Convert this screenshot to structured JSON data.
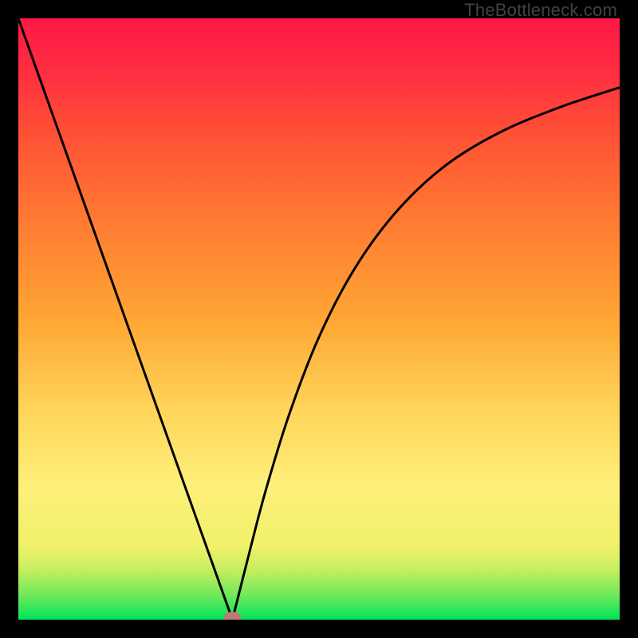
{
  "watermark": "TheBottleneck.com",
  "chart_data": {
    "type": "line",
    "title": "",
    "xlabel": "",
    "ylabel": "",
    "xlim": [
      0,
      1
    ],
    "ylim": [
      0,
      1
    ],
    "gradient_stops": [
      {
        "offset": 0.0,
        "color": "#00e45a"
      },
      {
        "offset": 0.04,
        "color": "#6de95a"
      },
      {
        "offset": 0.08,
        "color": "#c0ee5f"
      },
      {
        "offset": 0.12,
        "color": "#f0f16a"
      },
      {
        "offset": 0.22,
        "color": "#fdf07a"
      },
      {
        "offset": 0.35,
        "color": "#ffd459"
      },
      {
        "offset": 0.5,
        "color": "#ffa634"
      },
      {
        "offset": 0.65,
        "color": "#ff7e32"
      },
      {
        "offset": 0.8,
        "color": "#ff5335"
      },
      {
        "offset": 0.92,
        "color": "#ff2b41"
      },
      {
        "offset": 1.0,
        "color": "#ff1846"
      }
    ],
    "series": [
      {
        "name": "left-branch",
        "x": [
          0.0,
          0.356
        ],
        "y": [
          1.0,
          0.0
        ]
      },
      {
        "name": "right-branch",
        "x": [
          0.356,
          0.38,
          0.41,
          0.45,
          0.5,
          0.56,
          0.63,
          0.71,
          0.8,
          0.9,
          1.0
        ],
        "y": [
          0.0,
          0.095,
          0.21,
          0.34,
          0.47,
          0.585,
          0.68,
          0.755,
          0.81,
          0.852,
          0.885
        ]
      }
    ],
    "marker": {
      "x": 0.356,
      "y": 0.0,
      "color": "#bb7b74"
    }
  }
}
